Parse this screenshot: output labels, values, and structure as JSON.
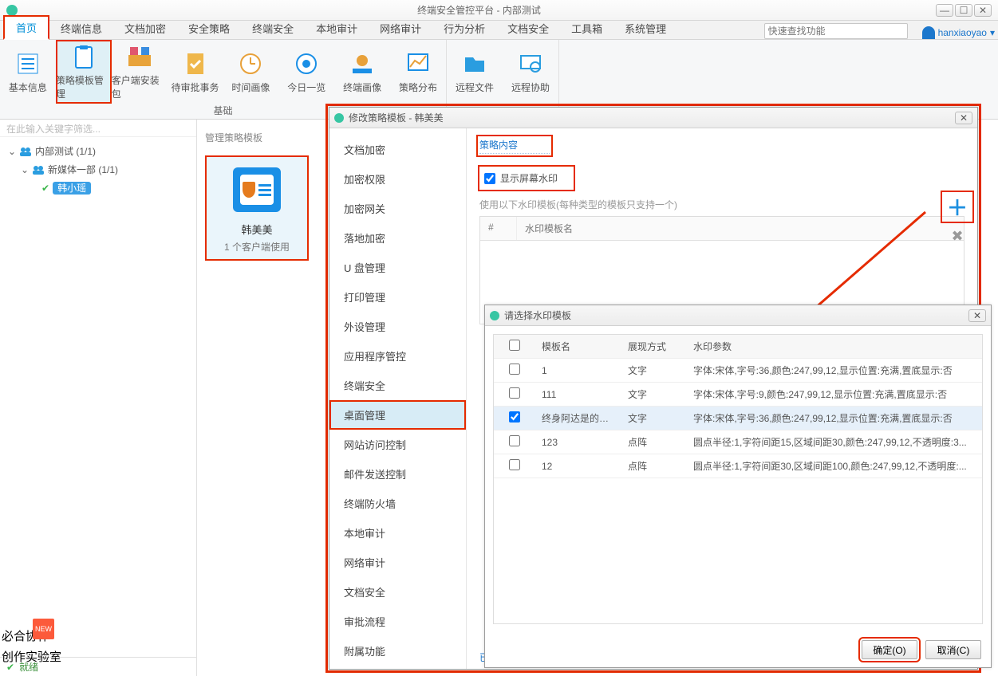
{
  "titlebar": {
    "title": "终端安全管控平台 - 内部测试"
  },
  "tabs": [
    "首页",
    "终端信息",
    "文档加密",
    "安全策略",
    "终端安全",
    "本地审计",
    "网络审计",
    "行为分析",
    "文档安全",
    "工具箱",
    "系统管理"
  ],
  "search_placeholder": "快速查找功能",
  "user": "hanxiaoyao",
  "ribbon": {
    "group1_caption": "基础",
    "items1": [
      "基本信息",
      "策略模板管理",
      "客户端安装包",
      "待审批事务",
      "时间画像",
      "今日一览",
      "终端画像",
      "策略分布"
    ],
    "items2": [
      "远程文件",
      "远程协助"
    ]
  },
  "left": {
    "filter_placeholder": "在此输入关键字筛选...",
    "n1": "内部测试 (1/1)",
    "n2": "新媒体一部 (1/1)",
    "n3": "韩小瑶",
    "status": "就绪"
  },
  "mid": {
    "title": "管理策略模板",
    "card_name": "韩美美",
    "card_use": "1 个客户端使用"
  },
  "dlg1": {
    "title": "修改策略模板 - 韩美美",
    "side": [
      "文档加密",
      "加密权限",
      "加密网关",
      "落地加密",
      "U 盘管理",
      "打印管理",
      "外设管理",
      "应用程序管控",
      "终端安全",
      "桌面管理",
      "网站访问控制",
      "邮件发送控制",
      "终端防火墙",
      "本地审计",
      "网络审计",
      "文档安全",
      "审批流程",
      "附属功能"
    ],
    "side_selected": 9,
    "sect": "策略内容",
    "chk": "显示屏幕水印",
    "hint": "使用以下水印模板(每种类型的模板只支持一个)",
    "wm_h1": "#",
    "wm_h2": "水印模板名",
    "sel": "已选择 韩小瑶"
  },
  "dlg2": {
    "title": "请选择水印模板",
    "head": {
      "chk": "",
      "nm": "模板名",
      "md": "展现方式",
      "pm": "水印参数"
    },
    "rows": [
      {
        "chk": false,
        "nm": "1",
        "md": "文字",
        "pm": "字体:宋体,字号:36,颜色:247,99,12,显示位置:充满,置底显示:否"
      },
      {
        "chk": false,
        "nm": "111",
        "md": "文字",
        "pm": "字体:宋体,字号:9,颜色:247,99,12,显示位置:充满,置底显示:否"
      },
      {
        "chk": true,
        "nm": "终身阿达是的有...",
        "md": "文字",
        "pm": "字体:宋体,字号:36,颜色:247,99,12,显示位置:充满,置底显示:否"
      },
      {
        "chk": false,
        "nm": "123",
        "md": "点阵",
        "pm": "圆点半径:1,字符间距15,区域间距30,颜色:247,99,12,不透明度:3..."
      },
      {
        "chk": false,
        "nm": "12",
        "md": "点阵",
        "pm": "圆点半径:1,字符间距30,区域间距100,颜色:247,99,12,不透明度:..."
      }
    ],
    "ok": "确定(O)",
    "cancel": "取消(C)"
  },
  "bl": {
    "a": "必合协作",
    "b": "创作实验室"
  }
}
